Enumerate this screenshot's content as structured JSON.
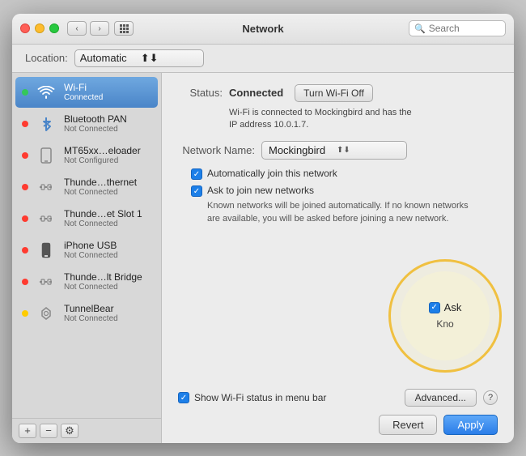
{
  "window": {
    "title": "Network",
    "search_placeholder": "Search"
  },
  "titlebar": {
    "back_label": "‹",
    "forward_label": "›"
  },
  "location": {
    "label": "Location:",
    "value": "Automatic"
  },
  "sidebar": {
    "items": [
      {
        "id": "wifi",
        "name": "Wi-Fi",
        "status": "Connected",
        "dot": "green",
        "active": true
      },
      {
        "id": "bluetooth",
        "name": "Bluetooth PAN",
        "status": "Not Connected",
        "dot": "red",
        "active": false
      },
      {
        "id": "mt65",
        "name": "MT65xx…eloader",
        "status": "Not Configured",
        "dot": "red",
        "active": false
      },
      {
        "id": "thundernet",
        "name": "Thunde…thernet",
        "status": "Not Connected",
        "dot": "red",
        "active": false
      },
      {
        "id": "thunderslot",
        "name": "Thunde…et Slot 1",
        "status": "Not Connected",
        "dot": "red",
        "active": false
      },
      {
        "id": "iphoneusb",
        "name": "iPhone USB",
        "status": "Not Connected",
        "dot": "red",
        "active": false
      },
      {
        "id": "thunderbridge",
        "name": "Thunde…lt Bridge",
        "status": "Not Connected",
        "dot": "red",
        "active": false
      },
      {
        "id": "tunnelbear",
        "name": "TunnelBear",
        "status": "Not Connected",
        "dot": "yellow",
        "active": false
      }
    ],
    "toolbar": {
      "add": "+",
      "remove": "−",
      "gear": "⚙"
    }
  },
  "panel": {
    "status_label": "Status:",
    "status_value": "Connected",
    "turn_off_label": "Turn Wi-Fi Off",
    "status_desc": "Wi-Fi is connected to Mockingbird and has the\nIP address 10.0.1.7.",
    "network_name_label": "Network Name:",
    "network_name_value": "Mockingbird",
    "auto_join_label": "Automatically join this network",
    "auto_join_checked": true,
    "ask_join_label": "Ask to join new networks",
    "ask_join_checked": true,
    "ask_join_desc": "Known networks will be joined automatically. If no known networks are available, you will be asked before joining a new network.",
    "show_wifi_label": "Show Wi-Fi status in menu bar",
    "show_wifi_checked": true,
    "advanced_label": "Advanced...",
    "help_label": "?",
    "revert_label": "Revert",
    "apply_label": "Apply"
  },
  "spotlight": {
    "checkbox_label": "Ask",
    "sub_label": "Kno"
  }
}
